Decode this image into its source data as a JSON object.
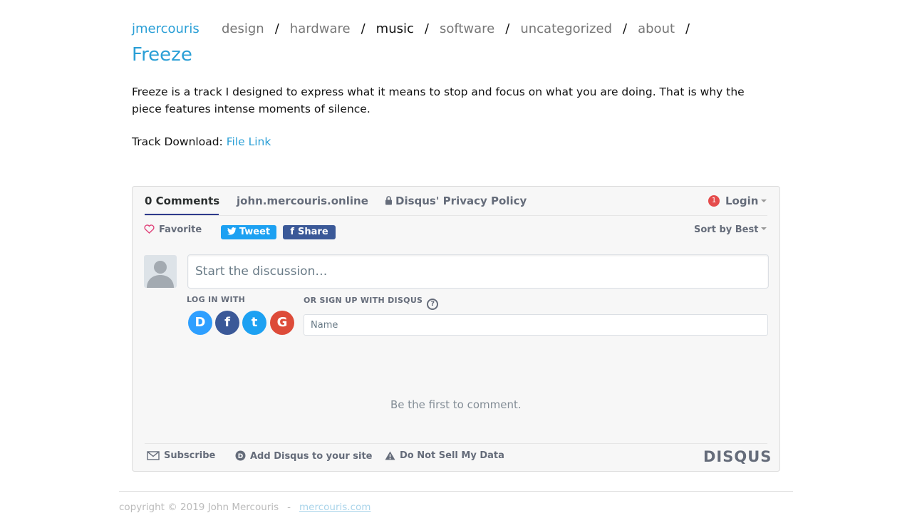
{
  "site": {
    "title": "jmercouris"
  },
  "nav": {
    "items": [
      {
        "label": "design",
        "active": false
      },
      {
        "label": "hardware",
        "active": false
      },
      {
        "label": "music",
        "active": true
      },
      {
        "label": "software",
        "active": false
      },
      {
        "label": "uncategorized",
        "active": false
      },
      {
        "label": "about",
        "active": false
      }
    ],
    "separator": "/"
  },
  "post": {
    "title": "Freeze",
    "body": "Freeze is a track I designed to express what it means to stop and focus on what you are doing. That is why the piece features intense moments of silence.",
    "download_label": "Track Download:",
    "download_link": "File Link"
  },
  "disqus": {
    "tabs": {
      "comments": "0 Comments",
      "site": "john.mercouris.online",
      "privacy": "Disqus' Privacy Policy"
    },
    "notification_count": "1",
    "login": "Login",
    "favorite": "Favorite",
    "tweet": "Tweet",
    "share": "Share",
    "sort": "Sort by Best",
    "input_placeholder": "Start the discussion…",
    "login_with": "LOG IN WITH",
    "signup_with": "OR SIGN UP WITH DISQUS",
    "help": "?",
    "social": {
      "disqus": "D",
      "facebook": "f",
      "twitter": "t",
      "google": "G"
    },
    "name_placeholder": "Name",
    "empty_message": "Be the first to comment.",
    "footer": {
      "subscribe": "Subscribe",
      "add": "Add Disqus to your site",
      "dnsmd": "Do Not Sell My Data"
    },
    "logo": "DISQUS",
    "colors": {
      "twitter": "#1da1f2",
      "facebook": "#3b5998",
      "google": "#dd4b39",
      "disqus": "#2e9fff",
      "accent": "#2e3a8c"
    }
  },
  "footer": {
    "copyright": "copyright © 2019 John Mercouris",
    "dash": "-",
    "link": "mercouris.com"
  },
  "colors": {
    "link": "#2a9fd6"
  }
}
